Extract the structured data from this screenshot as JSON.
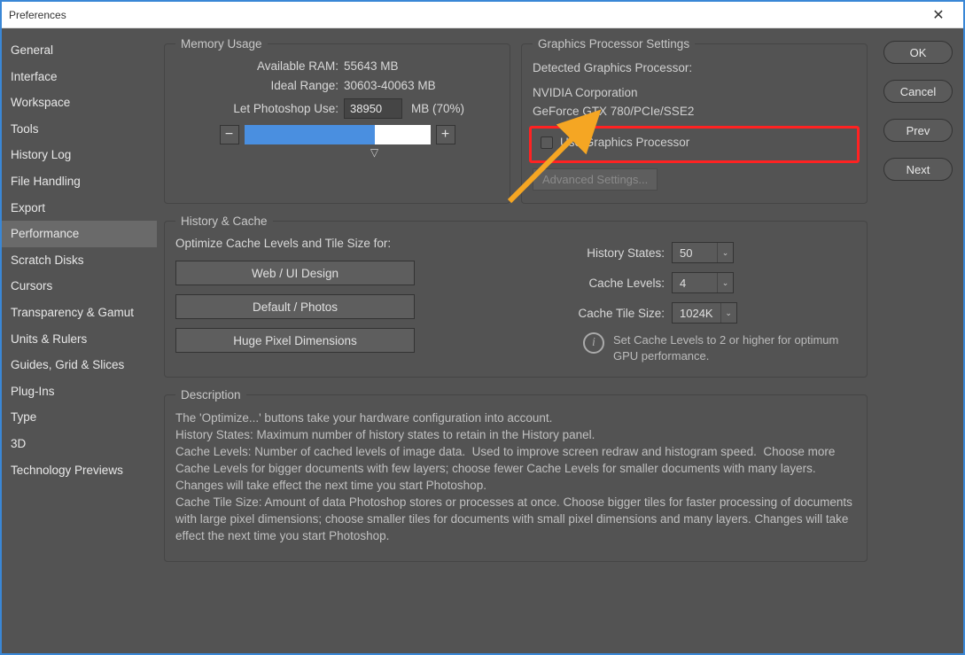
{
  "window": {
    "title": "Preferences"
  },
  "sidebar": {
    "items": [
      "General",
      "Interface",
      "Workspace",
      "Tools",
      "History Log",
      "File Handling",
      "Export",
      "Performance",
      "Scratch Disks",
      "Cursors",
      "Transparency & Gamut",
      "Units & Rulers",
      "Guides, Grid & Slices",
      "Plug-Ins",
      "Type",
      "3D",
      "Technology Previews"
    ],
    "selected_index": 7
  },
  "buttons": {
    "ok": "OK",
    "cancel": "Cancel",
    "prev": "Prev",
    "next": "Next"
  },
  "memory": {
    "legend": "Memory Usage",
    "available_label": "Available RAM:",
    "available_value": "55643 MB",
    "ideal_label": "Ideal Range:",
    "ideal_value": "30603-40063 MB",
    "use_label": "Let Photoshop Use:",
    "use_value": "38950",
    "unit_pct": "MB (70%)",
    "minus": "−",
    "plus": "+"
  },
  "gpu": {
    "legend": "Graphics Processor Settings",
    "detected_label": "Detected Graphics Processor:",
    "vendor": "NVIDIA Corporation",
    "device": "GeForce GTX 780/PCIe/SSE2",
    "checkbox_label": "Use Graphics Processor",
    "advanced": "Advanced Settings..."
  },
  "history_cache": {
    "legend": "History & Cache",
    "optimize_label": "Optimize Cache Levels and Tile Size for:",
    "btn_web": "Web / UI Design",
    "btn_default": "Default / Photos",
    "btn_huge": "Huge Pixel Dimensions",
    "hist_states_label": "History States:",
    "hist_states_value": "50",
    "cache_levels_label": "Cache Levels:",
    "cache_levels_value": "4",
    "cache_tile_label": "Cache Tile Size:",
    "cache_tile_value": "1024K",
    "info": "Set Cache Levels to 2 or higher for optimum GPU performance."
  },
  "description": {
    "legend": "Description",
    "text": "The 'Optimize...' buttons take your hardware configuration into account.\nHistory States: Maximum number of history states to retain in the History panel.\nCache Levels: Number of cached levels of image data.  Used to improve screen redraw and histogram speed.  Choose more Cache Levels for bigger documents with few layers; choose fewer Cache Levels for smaller documents with many layers. Changes will take effect the next time you start Photoshop.\nCache Tile Size: Amount of data Photoshop stores or processes at once. Choose bigger tiles for faster processing of documents with large pixel dimensions; choose smaller tiles for documents with small pixel dimensions and many layers. Changes will take effect the next time you start Photoshop."
  }
}
